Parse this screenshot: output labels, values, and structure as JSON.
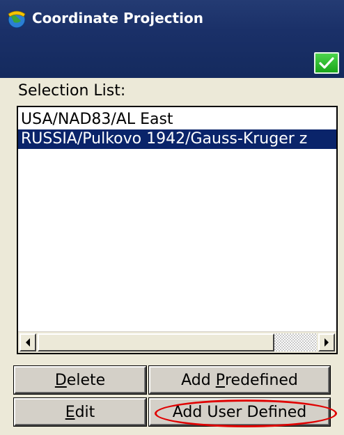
{
  "window": {
    "title": "Coordinate Projection",
    "icon": "app-globe-icon",
    "ok_icon": "checkmark-icon",
    "colors": {
      "titlebar": "#1a3068",
      "ok_button": "#1aa61a",
      "selection": "#0a246a",
      "highlight_oval": "#e00000"
    }
  },
  "selection_list": {
    "label": "Selection List:",
    "items": [
      {
        "text": "USA/NAD83/AL East",
        "selected": false
      },
      {
        "text": "RUSSIA/Pulkovo 1942/Gauss-Kruger z",
        "selected": true
      }
    ]
  },
  "buttons": {
    "delete": {
      "accel": "D",
      "rest": "elete"
    },
    "add_predefined": {
      "pre": "Add ",
      "accel": "P",
      "rest": "redefined"
    },
    "edit": {
      "accel": "E",
      "rest": "dit"
    },
    "add_user_defined": {
      "label": "Add User Defined"
    }
  }
}
